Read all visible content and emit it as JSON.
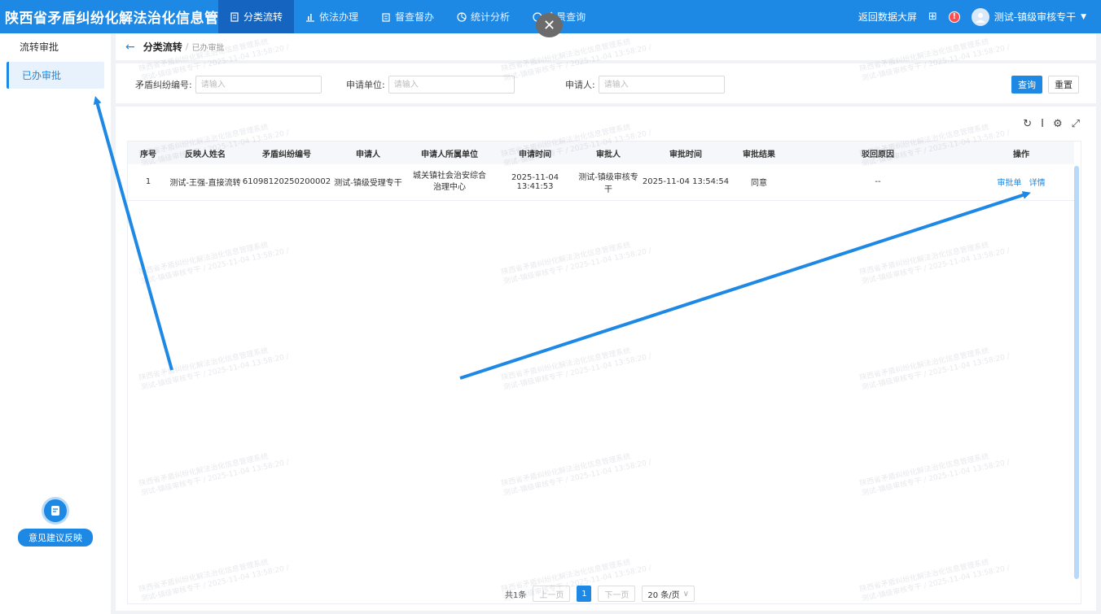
{
  "app_title": "陕西省矛盾纠纷化解法治化信息管理系统",
  "nav": [
    {
      "label": "分类流转",
      "icon": "document-icon",
      "active": true
    },
    {
      "label": "依法办理",
      "icon": "chart-icon",
      "active": false
    },
    {
      "label": "督查督办",
      "icon": "clipboard-icon",
      "active": false
    },
    {
      "label": "统计分析",
      "icon": "pie-icon",
      "active": false
    },
    {
      "label": "全景查询",
      "icon": "globe-icon",
      "active": false
    }
  ],
  "top_right": {
    "data_screen": "返回数据大屏",
    "user_name": "测试-镇级审核专干"
  },
  "sidebar": {
    "items": [
      {
        "label": "流转审批",
        "active": false
      },
      {
        "label": "已办审批",
        "active": true
      }
    ],
    "feedback_label": "意见建议反映"
  },
  "breadcrumb": {
    "main": "分类流转",
    "sep": "/",
    "sub": "已办审批"
  },
  "search": {
    "fields": [
      {
        "label": "矛盾纠纷编号:",
        "placeholder": "请输入"
      },
      {
        "label": "申请单位:",
        "placeholder": "请输入"
      },
      {
        "label": "申请人:",
        "placeholder": "请输入"
      }
    ],
    "query_label": "查询",
    "reset_label": "重置"
  },
  "table": {
    "headers": [
      "序号",
      "反映人姓名",
      "矛盾纠纷编号",
      "申请人",
      "申请人所属单位",
      "申请时间",
      "审批人",
      "审批时间",
      "审批结果",
      "驳回原因",
      "操作"
    ],
    "rows": [
      {
        "index": "1",
        "reporter": "测试-王强-直接流转",
        "code": "61098120250200002",
        "applicant": "测试-镇级受理专干",
        "unit": "城关镇社会治安综合治理中心",
        "apply_time": "2025-11-04 13:41:53",
        "approver": "测试-镇级审核专干",
        "approve_time": "2025-11-04 13:54:54",
        "result": "同意",
        "reject_reason": "--",
        "ops": [
          "审批单",
          "详情"
        ]
      }
    ]
  },
  "pager": {
    "total": "共1条",
    "prev": "上一页",
    "page": "1",
    "next": "下一页",
    "size": "20 条/页"
  },
  "watermark_line1": "陕西省矛盾纠纷化解法治化信息管理系统",
  "watermark_line2": "测试-镇级审核专干 / 2025-11-04 13:58:20 /",
  "colors": {
    "primary": "#1e88e5",
    "nav_active": "#1565c0"
  }
}
